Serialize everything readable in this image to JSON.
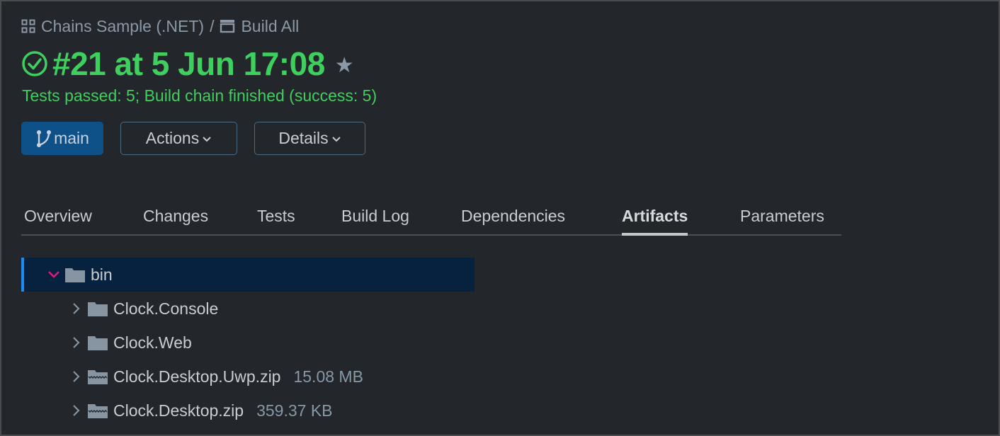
{
  "breadcrumb": {
    "project": "Chains Sample (.NET)",
    "separator": "/",
    "build_config": "Build All",
    "project_icon": "grid-icon",
    "config_icon": "build-config-icon"
  },
  "header": {
    "status_icon": "check-circle-icon",
    "title": "#21 at 5 Jun 17:08",
    "favorite_icon": "star-icon",
    "status_text": "Tests passed: 5; Build chain finished (success: 5)",
    "success_color": "#3fcf5e"
  },
  "buttons": {
    "branch": {
      "icon": "branch-icon",
      "label": "main",
      "color": "#0e5189"
    },
    "actions": {
      "label": "Actions",
      "icon": "chevron-down-icon"
    },
    "details": {
      "label": "Details",
      "icon": "chevron-down-icon"
    }
  },
  "tabs": [
    {
      "label": "Overview",
      "active": false
    },
    {
      "label": "Changes",
      "active": false
    },
    {
      "label": "Tests",
      "active": false
    },
    {
      "label": "Build Log",
      "active": false
    },
    {
      "label": "Dependencies",
      "active": false
    },
    {
      "label": "Artifacts",
      "active": true
    },
    {
      "label": "Parameters",
      "active": false
    }
  ],
  "artifacts": {
    "root": {
      "name": "bin",
      "expanded": true,
      "type": "folder"
    },
    "children": [
      {
        "name": "Clock.Console",
        "type": "folder",
        "size": ""
      },
      {
        "name": "Clock.Web",
        "type": "folder",
        "size": ""
      },
      {
        "name": "Clock.Desktop.Uwp.zip",
        "type": "archive",
        "size": "15.08 MB"
      },
      {
        "name": "Clock.Desktop.zip",
        "type": "archive",
        "size": "359.37 KB"
      }
    ]
  }
}
